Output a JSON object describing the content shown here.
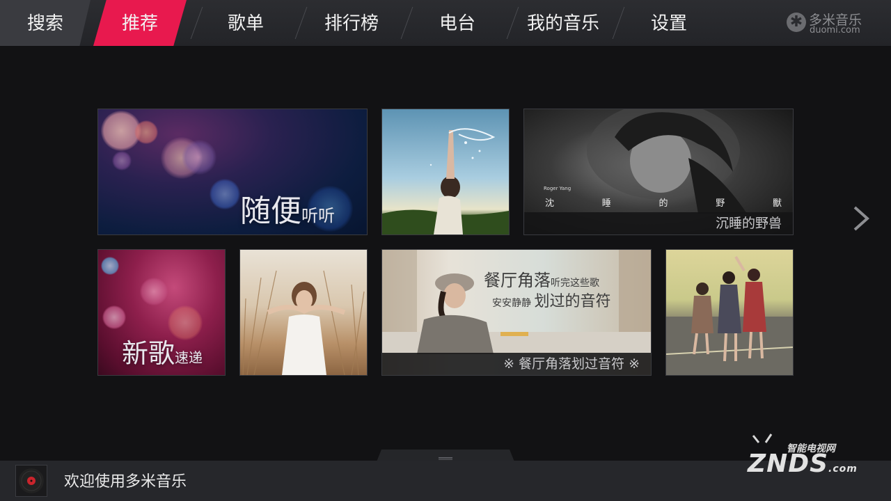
{
  "nav": {
    "tabs": [
      {
        "label": "搜索"
      },
      {
        "label": "推荐"
      },
      {
        "label": "歌单"
      },
      {
        "label": "排行榜"
      },
      {
        "label": "电台"
      },
      {
        "label": "我的音乐"
      },
      {
        "label": "设置"
      }
    ],
    "active_tab": "推荐"
  },
  "logo": {
    "name_cn": "多米音乐",
    "domain": "duomi.com",
    "mark": "✱"
  },
  "tiles": {
    "random": {
      "title_main": "随便",
      "title_small": "听听"
    },
    "beast": {
      "credit": "Roger Yang",
      "lyrics": [
        "沈",
        "睡",
        "的",
        "野",
        "獸"
      ],
      "caption": "沉睡的野兽"
    },
    "new_songs": {
      "title_main": "新歌",
      "title_small": "速递"
    },
    "restaurant": {
      "promo_main": "餐厅角落",
      "promo_small": "听完这些歌",
      "promo2_small": "安安静静",
      "promo2_main": "划过的音符",
      "caption": "※ 餐厅角落划过音符 ※"
    }
  },
  "bottom": {
    "welcome": "欢迎使用多米音乐"
  },
  "watermark": {
    "cn": "智能电视网",
    "en": "ZNDS",
    "suffix": ".com"
  },
  "colors": {
    "accent": "#e8194e",
    "background": "#121214",
    "bar": "#26272b"
  }
}
